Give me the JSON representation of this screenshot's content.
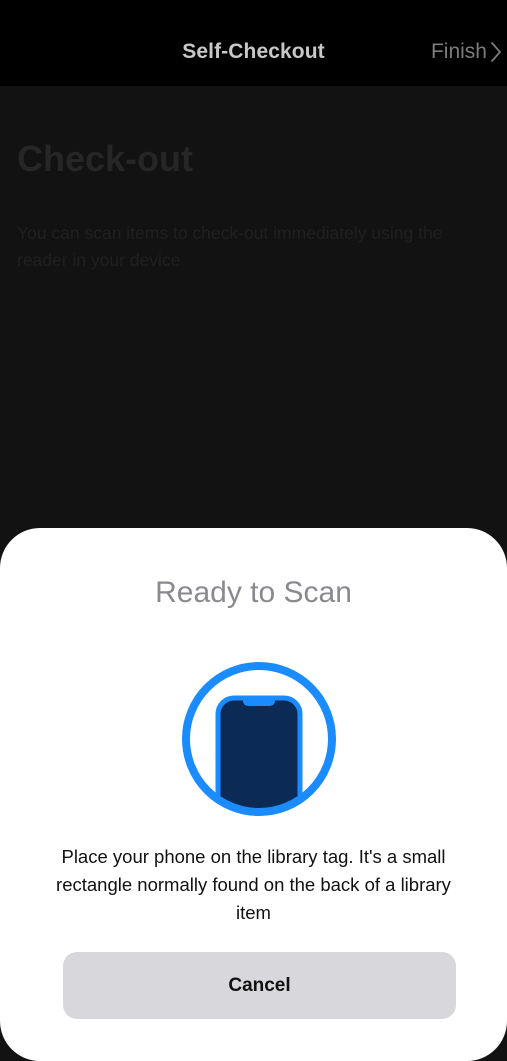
{
  "nav": {
    "title": "Self-Checkout",
    "finish_label": "Finish",
    "finish_icon": "chevron-right-icon"
  },
  "page": {
    "heading": "Check-out",
    "description": "You can scan items to check-out immediately using the reader in your device"
  },
  "scan_sheet": {
    "title": "Ready to Scan",
    "graphic_icon": "phone-scan-icon",
    "message": "Place your phone on the library tag. It's a small rectangle normally found on the back of a library item",
    "cancel_label": "Cancel"
  },
  "colors": {
    "accent_blue": "#1a8cff",
    "phone_navy": "#0b2a55",
    "sheet_background": "#ffffff",
    "cancel_background": "#d8d8dc"
  }
}
